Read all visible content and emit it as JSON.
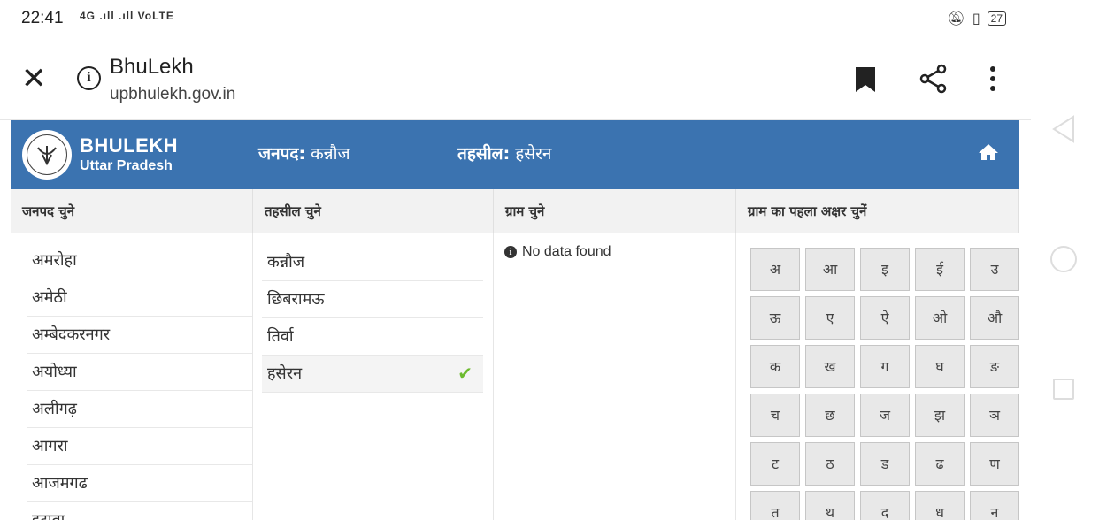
{
  "status_bar": {
    "time": "22:41",
    "signal_text": "4G .ıll .ıll VoLTE",
    "battery": "27"
  },
  "browser": {
    "title": "BhuLekh",
    "url": "upbhulekh.gov.in"
  },
  "site": {
    "brand": "BHULEKH",
    "state": "Uttar Pradesh",
    "janpad_label": "जनपद:",
    "janpad_value": "कन्नौज",
    "tehsil_label": "तहसील:",
    "tehsil_value": "हसेरन"
  },
  "columns": {
    "janpad": {
      "header": "जनपद चुने",
      "items": [
        "अमरोहा",
        "अमेठी",
        "अम्बेदकरनगर",
        "अयोध्या",
        "अलीगढ़",
        "आगरा",
        "आजमगढ",
        "इटावा"
      ]
    },
    "tehsil": {
      "header": "तहसील चुने",
      "items": [
        "कन्नौज",
        "छिबरामऊ",
        "तिर्वा",
        "हसेरन"
      ],
      "selected": "हसेरन"
    },
    "gram": {
      "header": "ग्राम चुने",
      "message": "No data found"
    },
    "letter": {
      "header": "ग्राम का पहला अक्षर चुनें",
      "keys": [
        "अ",
        "आ",
        "इ",
        "ई",
        "उ",
        "ऊ",
        "ए",
        "ऐ",
        "ओ",
        "औ",
        "क",
        "ख",
        "ग",
        "घ",
        "ङ",
        "च",
        "छ",
        "ज",
        "झ",
        "ञ",
        "ट",
        "ठ",
        "ड",
        "ढ",
        "ण",
        "त",
        "थ",
        "द",
        "ध",
        "न"
      ]
    }
  },
  "colors": {
    "header_blue": "#3b73b0",
    "check_green": "#6dbb2f"
  }
}
